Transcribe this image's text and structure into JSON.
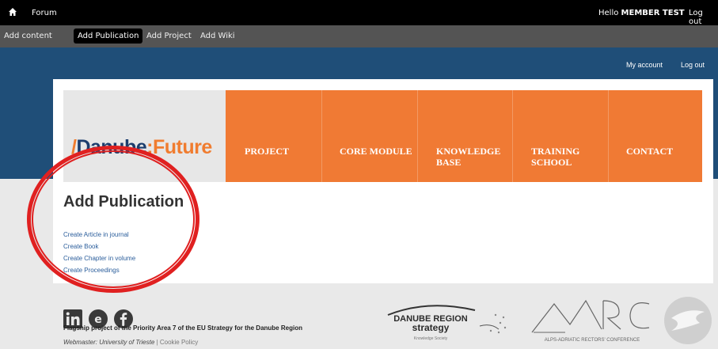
{
  "toolbar": {
    "forum": "Forum",
    "hello": "Hello",
    "user": "MEMBER TEST",
    "logout": "Log out"
  },
  "shortcuts": [
    "Add content",
    "Add Publication",
    "Add Project",
    "Add Wiki"
  ],
  "account": {
    "my_account": "My account",
    "logout": "Log out"
  },
  "logo": {
    "prefix": "/",
    "name_a": "Danube",
    "sep": ":",
    "name_b": "Future"
  },
  "nav": [
    {
      "line1": "PROJECT",
      "line2": ""
    },
    {
      "line1": "CORE MODULE",
      "line2": ""
    },
    {
      "line1": "KNOWLEDGE",
      "line2": "BASE"
    },
    {
      "line1": "TRAINING",
      "line2": "SCHOOL"
    },
    {
      "line1": "CONTACT",
      "line2": ""
    }
  ],
  "page": {
    "title": "Add Publication",
    "links": [
      "Create Article in journal",
      "Create Book",
      "Create Chapter in volume",
      "Create Proceedings"
    ]
  },
  "footer": {
    "flagship": "Flagship project of the Priority Area 7 of the EU Strategy for the Danube Region",
    "webmaster": "Webmaster: University of Trieste",
    "separator": "|",
    "cookie": "Cookie Policy",
    "danube_line1": "DANUBE REGION",
    "danube_line2": "strategy",
    "danube_line3": "Knowledge Society",
    "arc_text": "ALPS-ADRIATIC RECTORS' CONFERENCE"
  },
  "colors": {
    "orange": "#f07a34",
    "blue": "#1f4e78",
    "annotation": "#e02020"
  }
}
